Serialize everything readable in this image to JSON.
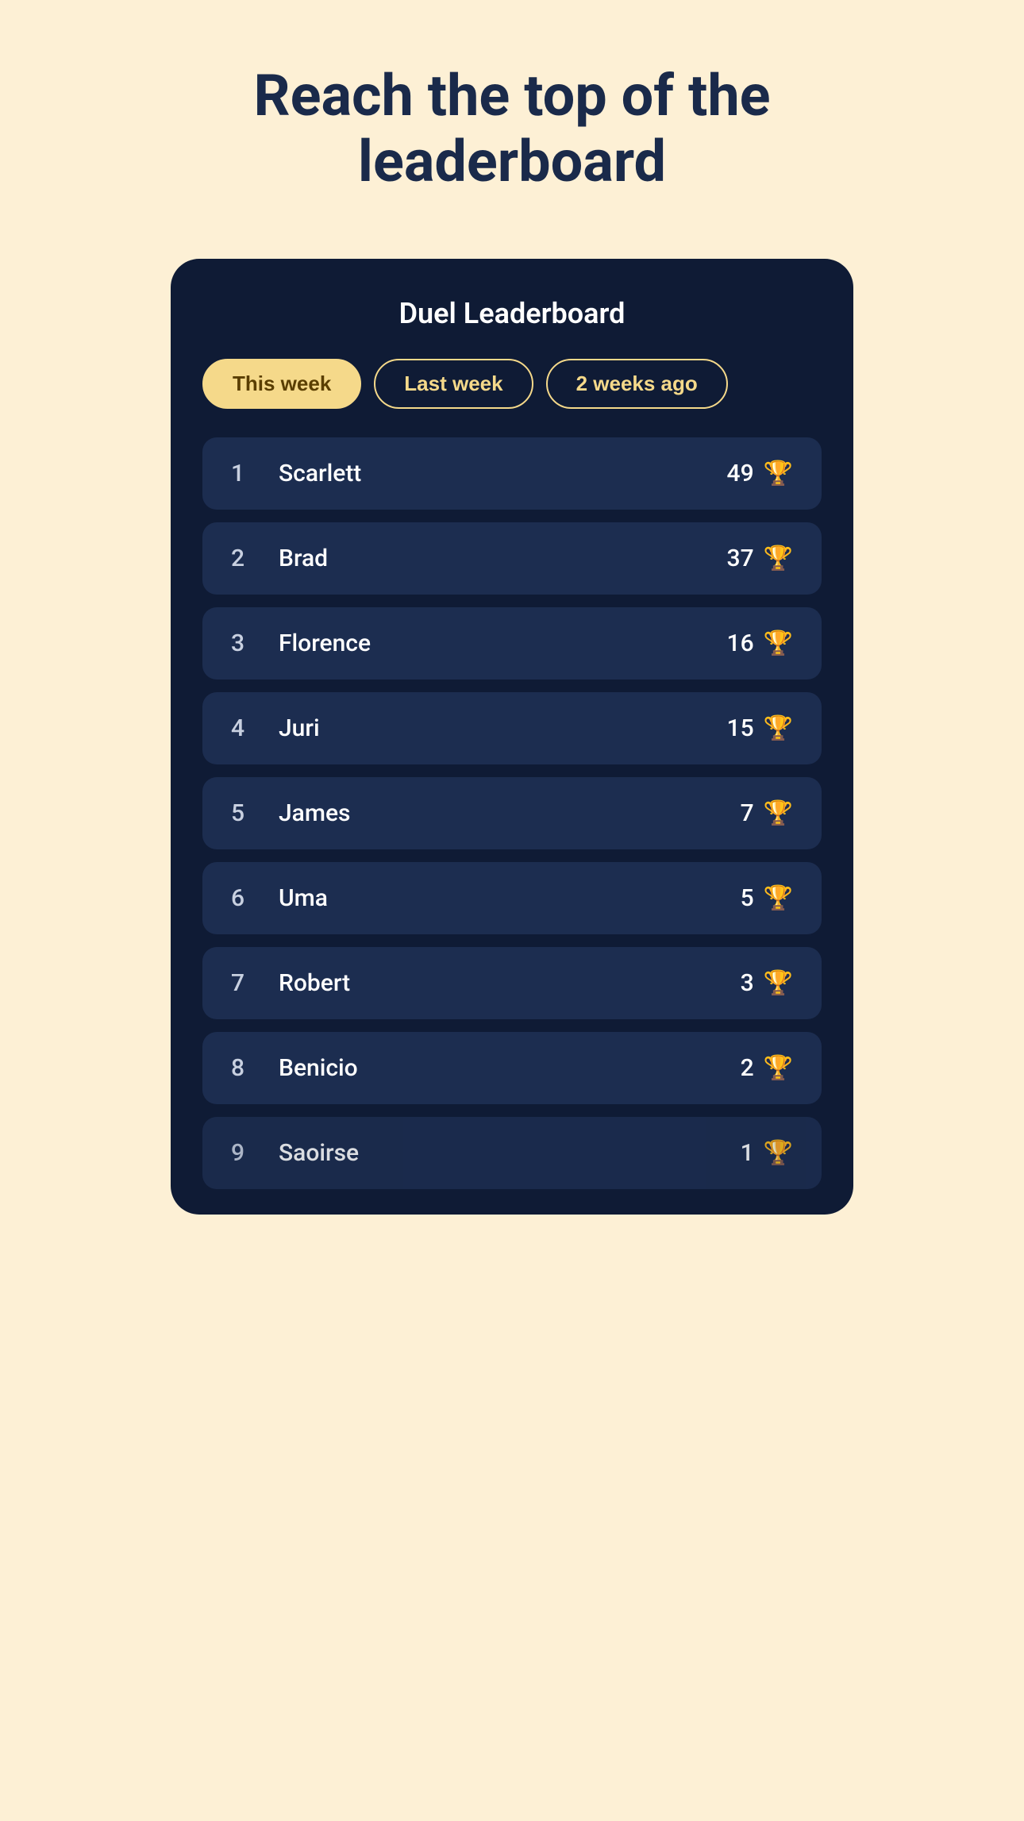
{
  "page": {
    "title_line1": "Reach the top of the",
    "title_line2": "leaderboard",
    "background_color": "#fdf0d5"
  },
  "leaderboard": {
    "title": "Duel Leaderboard",
    "tabs": [
      {
        "id": "this-week",
        "label": "This week",
        "active": true
      },
      {
        "id": "last-week",
        "label": "Last week",
        "active": false
      },
      {
        "id": "2-weeks-ago",
        "label": "2 weeks ago",
        "active": false
      }
    ],
    "entries": [
      {
        "rank": "1",
        "name": "Scarlett",
        "score": "49"
      },
      {
        "rank": "2",
        "name": "Brad",
        "score": "37"
      },
      {
        "rank": "3",
        "name": "Florence",
        "score": "16"
      },
      {
        "rank": "4",
        "name": "Juri",
        "score": "15"
      },
      {
        "rank": "5",
        "name": "James",
        "score": "7"
      },
      {
        "rank": "6",
        "name": "Uma",
        "score": "5"
      },
      {
        "rank": "7",
        "name": "Robert",
        "score": "3"
      },
      {
        "rank": "8",
        "name": "Benicio",
        "score": "2"
      },
      {
        "rank": "9",
        "name": "Saoirse",
        "score": "1"
      }
    ]
  }
}
